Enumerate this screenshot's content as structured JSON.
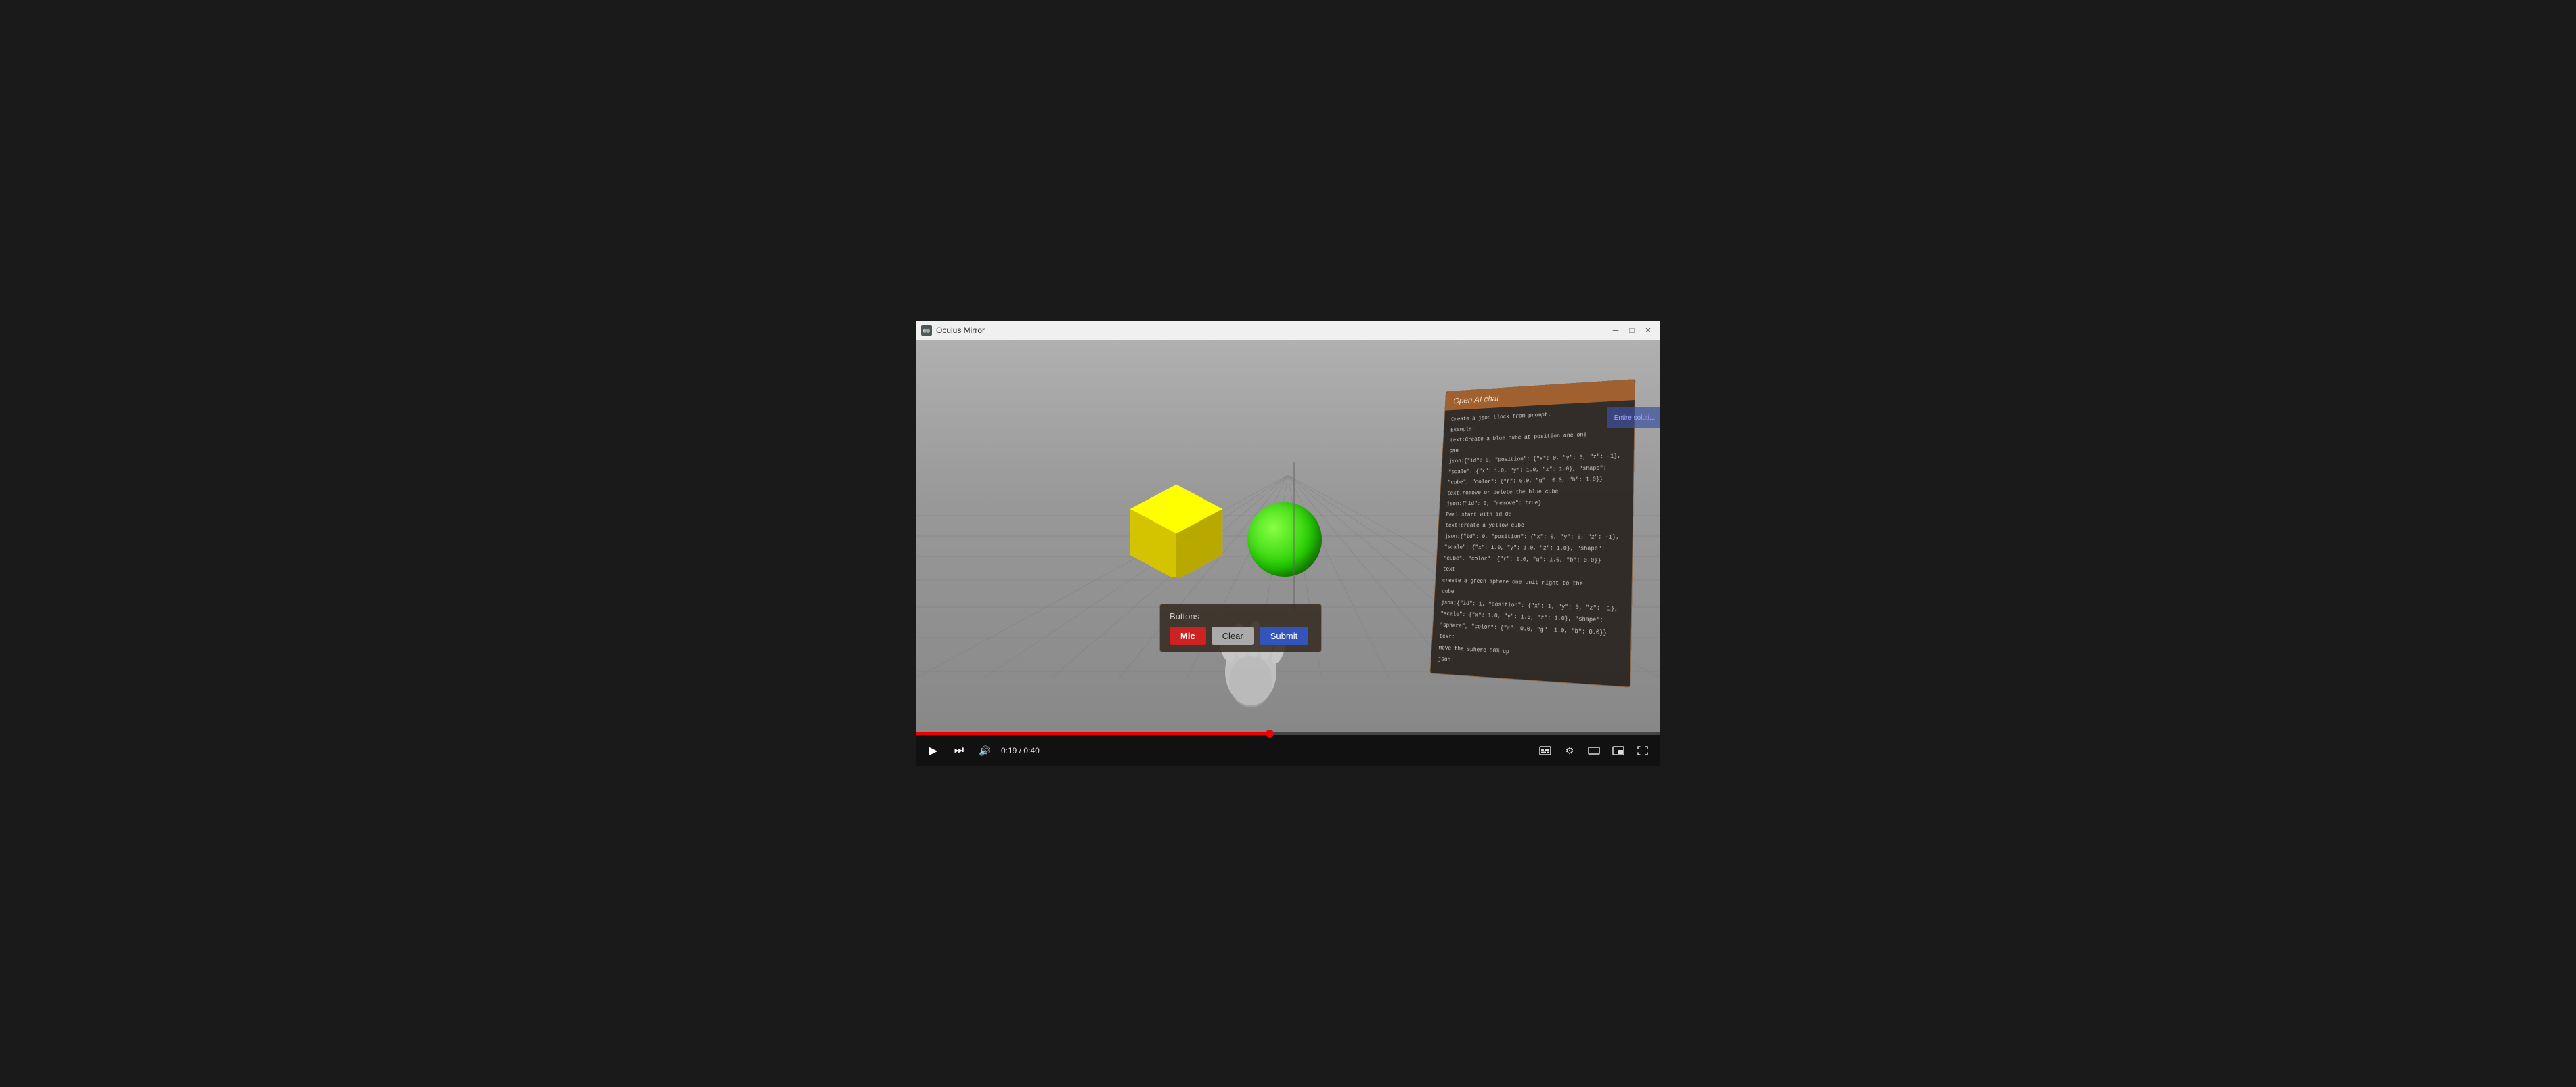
{
  "titleBar": {
    "icon": "🥽",
    "title": "Oculus Mirror",
    "minimizeLabel": "─",
    "maximizeLabel": "□",
    "closeLabel": "✕"
  },
  "rightSidebar": {
    "label": "Entire soluti..."
  },
  "aiChat": {
    "headerLabel": "Open AI chat",
    "body": [
      "Create a json block from prompt.",
      "Example:",
      "text:Create a blue cube at position one one one",
      "json:{\"id\": 0, \"position\": {\"x\": 0, \"y\": 0, \"z\": -1},",
      "\"scale\": {\"x\": 1.0, \"y\": 1.0, \"z\": 1.0}, \"shape\":",
      "\"cube\", \"color\": {\"r\": 0.0, \"g\": 0.0, \"b\": 1.0}}",
      "text:remove or delete the blue cube",
      "json:{\"id\": 0, \"remove\": true}",
      "Real start with id 0:",
      "text:create a yellow cube",
      "json:{\"id\": 0, \"position\": {\"x\": 0, \"y\": 0, \"z\": -1},",
      "\"scale\": {\"x\": 1.0, \"y\": 1.0, \"z\": 1.0}, \"shape\":",
      "\"cube\", \"color\": {\"r\": 1.0, \"g\": 1.0, \"b\": 0.0}}",
      "text",
      "create a green sphere one unit right to the cube",
      "json:{\"id\": 1, \"position\": {\"x\": 1, \"y\": 0, \"z\": -1},",
      "\"scale\": {\"x\": 1.0, \"y\": 1.0, \"z\": 1.0}, \"shape\":",
      "\"sphere\", \"color\": {\"r\": 0.0, \"g\": 1.0, \"b\": 0.0}}",
      "text:",
      "move the sphere 50% up",
      "json:"
    ]
  },
  "buttonsPanel": {
    "title": "Buttons",
    "micLabel": "Mic",
    "clearLabel": "Clear",
    "submitLabel": "Submit"
  },
  "controls": {
    "playIcon": "▶",
    "nextIcon": "⏭",
    "volumeIcon": "🔊",
    "currentTime": "0:19",
    "separator": "/",
    "totalTime": "0:40",
    "captionsIcon": "⊡",
    "settingsIcon": "⚙",
    "theaterIcon": "⊟",
    "miniPlayerIcon": "⊞",
    "fullscreenIcon": "⛶"
  }
}
